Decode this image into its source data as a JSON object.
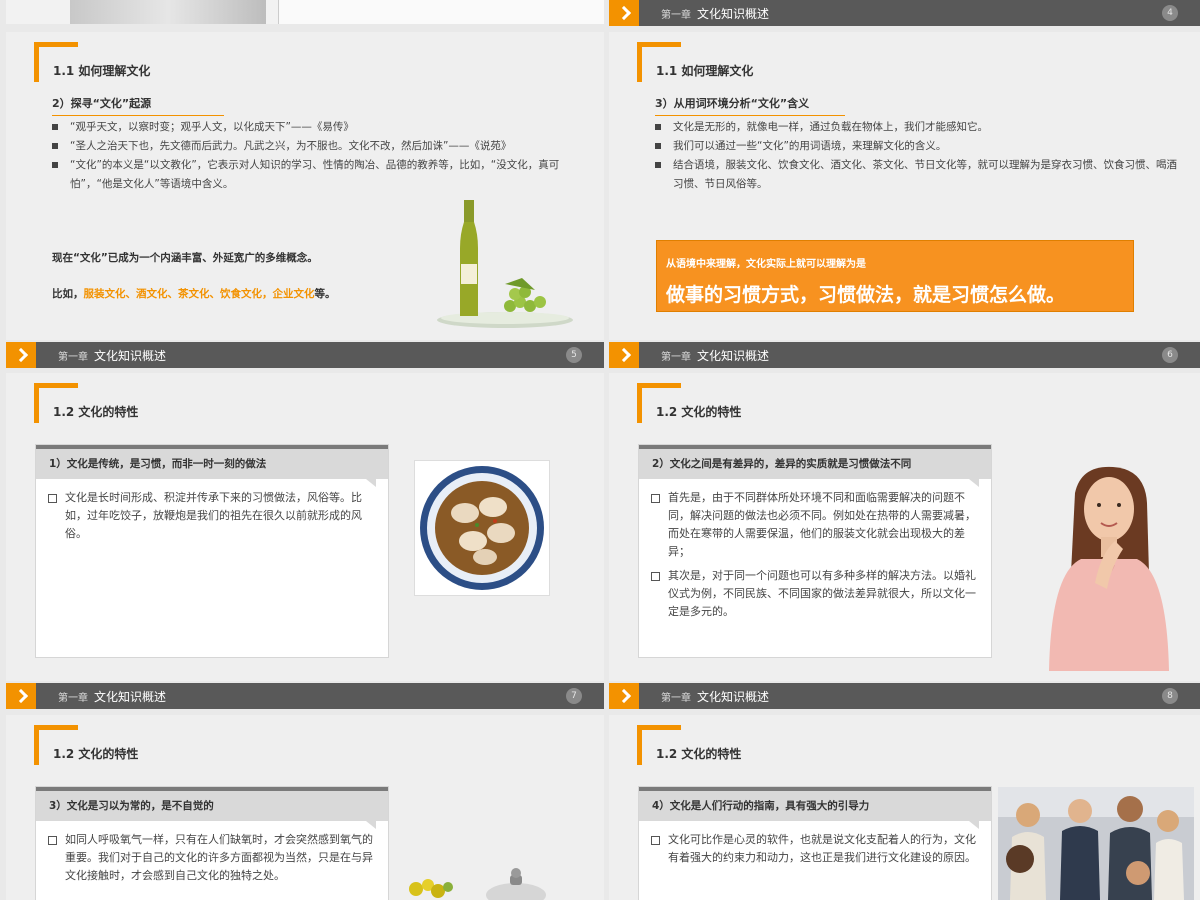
{
  "top_row": {
    "left_footer": {
      "chapter": "",
      "title": ""
    },
    "right_footer": {
      "chapter": "第一章",
      "title": "文化知识概述",
      "page": "4"
    }
  },
  "footers": [
    {
      "chapter": "第一章",
      "title": "文化知识概述",
      "page": "5"
    },
    {
      "chapter": "第一章",
      "title": "文化知识概述",
      "page": "6"
    },
    {
      "chapter": "第一章",
      "title": "文化知识概述",
      "page": "7"
    },
    {
      "chapter": "第一章",
      "title": "文化知识概述",
      "page": "8"
    }
  ],
  "slide5": {
    "section": "1.1 如何理解文化",
    "subhead": "2）探寻“文化”起源",
    "bullets": [
      "“观乎天文，以察时变；观乎人文，以化成天下”——《易传》",
      "“圣人之治天下也，先文德而后武力。凡武之兴，为不服也。文化不改，然后加诛”——《说苑》",
      "“文化”的本义是“以文教化”，它表示对人知识的学习、性情的陶冶、品德的教养等，比如，“没文化，真可怕”，“他是文化人”等语境中含义。"
    ],
    "line1": "现在“文化”已成为一个内涵丰富、外延宽广的多维概念。",
    "line2_prefix": "比如，",
    "line2_orange": "服装文化、酒文化、茶文化、饮食文化，企业文化",
    "line2_suffix": "等。"
  },
  "slide6": {
    "section": "1.1 如何理解文化",
    "subhead": "3）从用词环境分析“文化”含义",
    "bullets": [
      "文化是无形的，就像电一样，通过负载在物体上，我们才能感知它。",
      "我们可以通过一些“文化”的用词语境，来理解文化的含义。",
      "结合语境，服装文化、饮食文化、酒文化、茶文化、节日文化等，就可以理解为是穿衣习惯、饮食习惯、喝酒习惯、节日风俗等。"
    ],
    "callout_small": "从语境中来理解，文化实际上就可以理解为是",
    "callout_big": "做事的习惯方式，习惯做法，就是习惯怎么做。"
  },
  "slide7": {
    "section": "1.2 文化的特性",
    "card_head": "1）文化是传统，是习惯，而非一时一刻的做法",
    "paras": [
      "文化是长时间形成、积淀并传承下来的习惯做法，风俗等。比如，过年吃饺子，放鞭炮是我们的祖先在很久以前就形成的风俗。"
    ]
  },
  "slide8": {
    "section": "1.2 文化的特性",
    "card_head": "2）文化之间是有差异的，差异的实质就是习惯做法不同",
    "paras": [
      "首先是，由于不同群体所处环境不同和面临需要解决的问题不同，解决问题的做法也必须不同。例如处在热带的人需要减暑，而处在寒带的人需要保温，他们的服装文化就会出现极大的差异；",
      "其次是，对于同一个问题也可以有多种多样的解决方法。以婚礼仪式为例，不同民族、不同国家的做法差异就很大，所以文化一定是多元的。"
    ]
  },
  "slide9": {
    "section": "1.2 文化的特性",
    "card_head": "3）文化是习以为常的，是不自觉的",
    "paras": [
      "如同人呼吸氧气一样，只有在人们缺氧时，才会突然感到氧气的重要。我们对于自己的文化的许多方面都视为当然，只是在与异文化接触时，才会感到自己文化的独特之处。"
    ]
  },
  "slide10": {
    "section": "1.2 文化的特性",
    "card_head": "4）文化是人们行动的指南，具有强大的引导力",
    "paras": [
      "文化可比作是心灵的软件，也就是说文化支配着人的行为，文化有着强大的约束力和动力，这也正是我们进行文化建设的原因。"
    ]
  }
}
